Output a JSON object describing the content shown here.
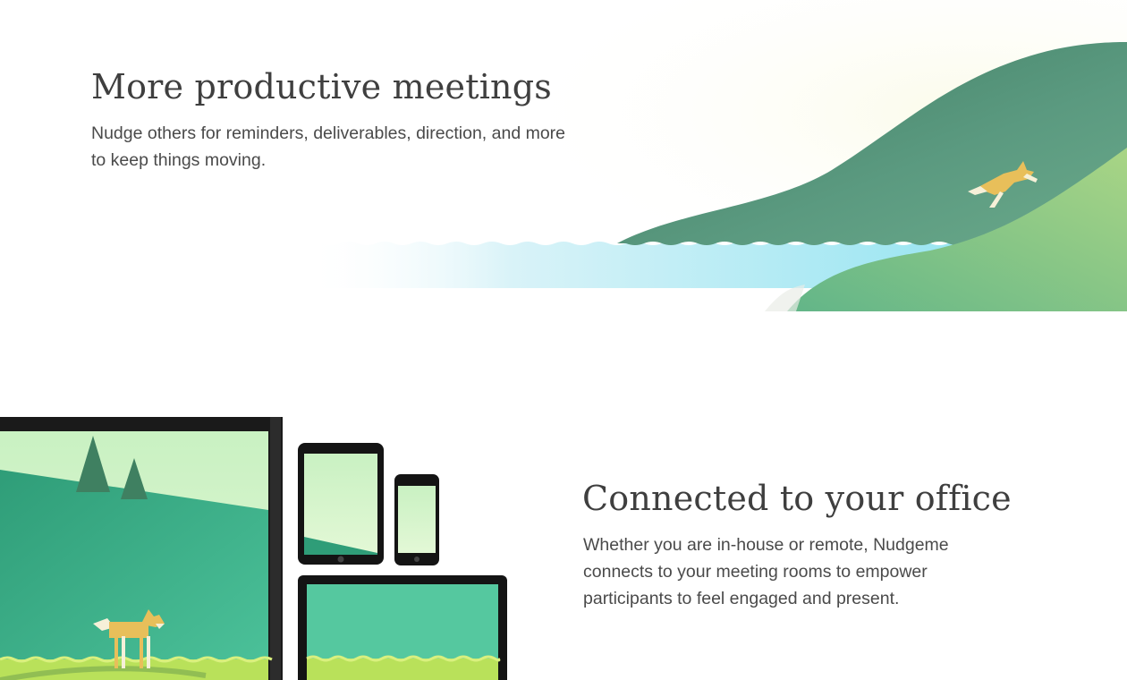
{
  "sections": [
    {
      "heading": "More productive meetings",
      "body": "Nudge others for reminders, deliverables, direction, and more to keep things moving."
    },
    {
      "heading": "Connected to your office",
      "body": "Whether you are in-house or remote, Nudgeme connects to your meeting rooms to empower participants to feel engaged and present."
    }
  ],
  "illustrations": {
    "landscape": "fox-leaping-hills-lake",
    "devices": "tv-tablet-phone-laptop-with-fox"
  },
  "colors": {
    "heading_text": "#3f3f3f",
    "body_text": "#4a4a4a",
    "dark_hill": "#4f8c72",
    "light_hill": "#7cc487",
    "water": "#8fe3f0",
    "fox": "#e8bf5a",
    "device_frame": "#1a1a1a"
  }
}
